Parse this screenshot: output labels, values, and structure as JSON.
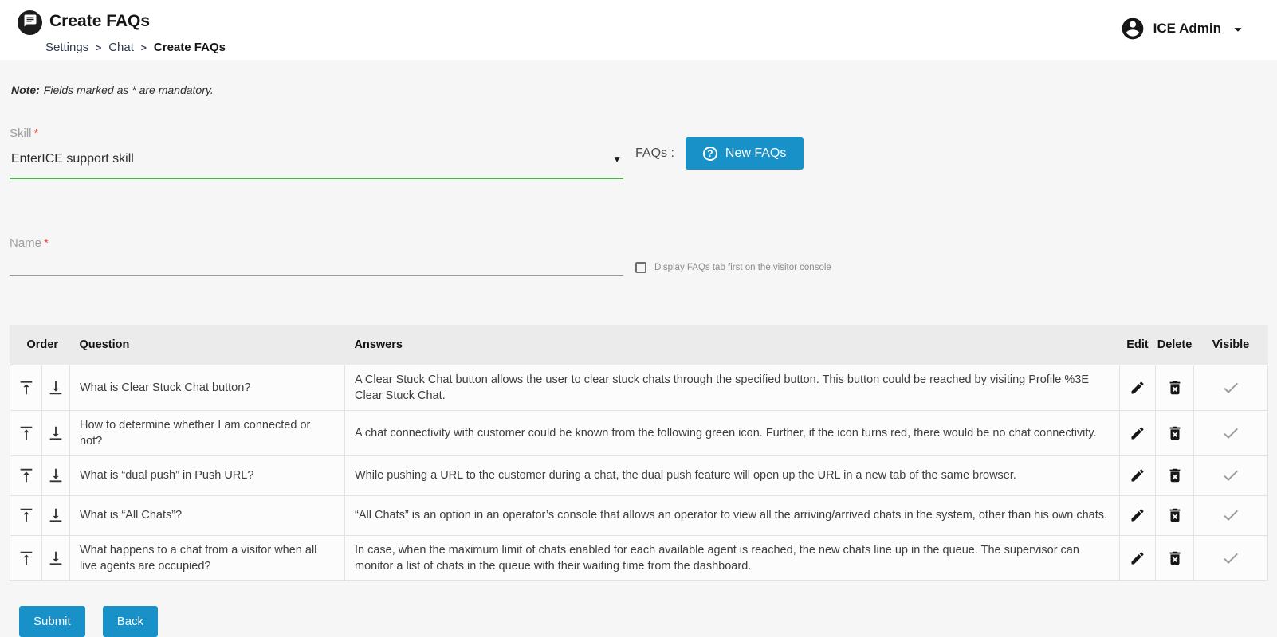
{
  "header": {
    "title": "Create FAQs",
    "breadcrumb": [
      {
        "label": "Settings"
      },
      {
        "label": "Chat"
      },
      {
        "label": "Create FAQs"
      }
    ],
    "separator": ">",
    "user_name": "ICE Admin"
  },
  "note": {
    "prefix": "Note:",
    "text": "Fields marked as * are mandatory."
  },
  "form": {
    "skill": {
      "label": "Skill",
      "required_mark": "*",
      "value": "EnterICE support skill",
      "caret": "▼"
    },
    "faqs": {
      "label": "FAQs :",
      "button_label": "New FAQs",
      "help_glyph": "?"
    },
    "name": {
      "label": "Name",
      "required_mark": "*",
      "value": ""
    },
    "visitor_checkbox": {
      "label": "Display FAQs tab first on the visitor console",
      "checked": false
    }
  },
  "table": {
    "headers": {
      "order": "Order",
      "question": "Question",
      "answers": "Answers",
      "edit": "Edit",
      "delete": "Delete",
      "visible": "Visible"
    },
    "rows": [
      {
        "question": "What is Clear Stuck Chat button?",
        "answer": "A Clear Stuck Chat button allows the user to clear stuck chats through the specified button. This button could be reached by visiting Profile %3E Clear Stuck Chat."
      },
      {
        "question": "How to determine whether I am connected or not?",
        "answer": "A chat connectivity with customer could be known from the following green icon. Further, if the icon turns red, there would be no chat connectivity."
      },
      {
        "question": "What is “dual push” in Push URL?",
        "answer": "While pushing a URL to the customer during a chat, the dual push feature will open up the URL in a new tab of the same browser."
      },
      {
        "question": "What is “All Chats”?",
        "answer": "“All Chats” is an option in an operator’s console that allows an operator to view all the arriving/arrived chats in the system, other than his own chats."
      },
      {
        "question": "What happens to a chat from a visitor when all live agents are occupied?",
        "answer": "In case, when the maximum limit of chats enabled for each available agent is reached, the new chats line up in the queue. The supervisor can monitor a list of chats in the queue with their waiting time from the dashboard."
      }
    ]
  },
  "actions": {
    "submit_label": "Submit",
    "back_label": "Back"
  },
  "icons": {
    "logo": "chat-message-icon",
    "avatar": "account-circle-icon",
    "order_up": "move-to-top-icon",
    "order_down": "move-to-bottom-icon",
    "edit": "pencil-icon",
    "delete": "trash-x-icon",
    "visible": "check-icon"
  },
  "colors": {
    "accent_blue": "#1791c8",
    "green_underline": "#4caf50",
    "required_red": "#f44336",
    "check_gray": "#9e9e9e",
    "page_bg": "#f6f6f6",
    "table_header_bg": "#ebebeb"
  }
}
